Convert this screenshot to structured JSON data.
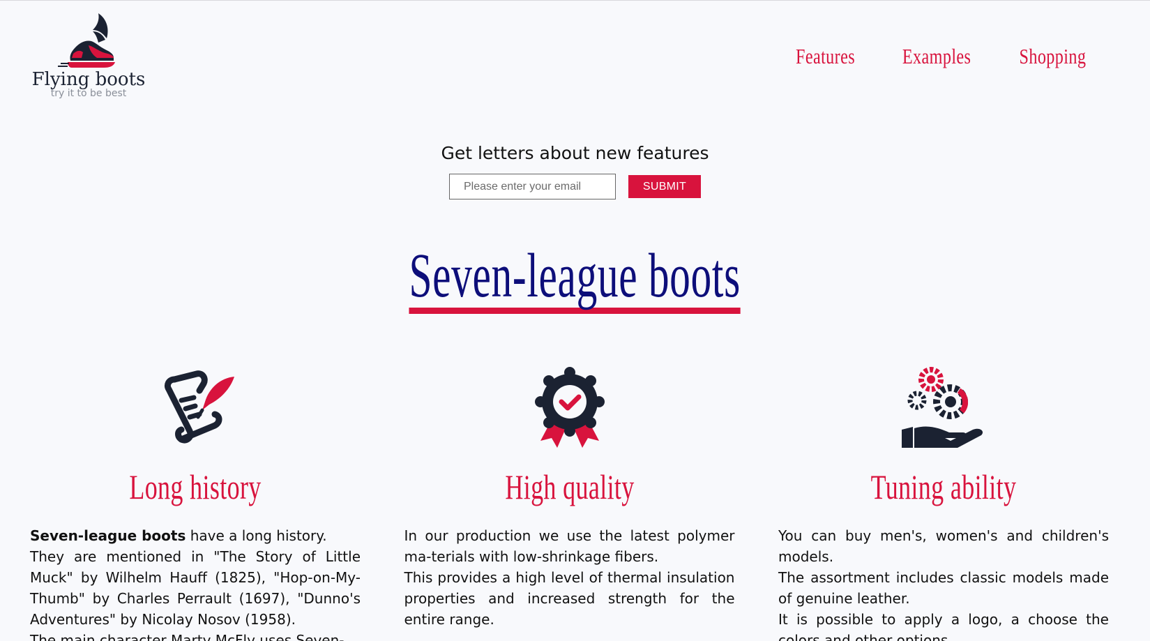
{
  "brand": {
    "name": "Flying boots",
    "tagline": "try it to be best",
    "colors": {
      "accent": "#d8133d",
      "dark": "#1b2232",
      "headline": "#0d0e7a"
    }
  },
  "nav": {
    "items": [
      {
        "label": "Features"
      },
      {
        "label": "Examples"
      },
      {
        "label": "Shopping"
      }
    ]
  },
  "subscribe": {
    "heading": "Get letters about new features",
    "email_placeholder": "Please enter your email",
    "email_value": "",
    "submit_label": "SUBMIT"
  },
  "hero": {
    "title": "Seven-league boots"
  },
  "features": [
    {
      "icon": "scroll-quill-icon",
      "title": "Long history",
      "lead_bold": "Seven-league boots",
      "lead_rest": " have a long history.",
      "paragraphs": [
        "They are mentioned in \"The Story of Little Muck\" by Wilhelm Hauff (1825), \"Hop-on-My-Thumb\" by Charles Perrault (1697), \"Dunno's Adventures\" by Nicolay Nosov (1958).",
        "The main character Marty McFly uses Seven-"
      ]
    },
    {
      "icon": "award-badge-icon",
      "title": "High quality",
      "paragraphs": [
        "In our production we use the latest polymer ma-terials with low-shrinkage fibers.",
        "This provides a high level of thermal insulation properties and increased strength for the entire range."
      ]
    },
    {
      "icon": "gears-hand-icon",
      "title": "Tuning ability",
      "paragraphs": [
        "You can buy men's, women's and children's models.",
        "The assortment includes classic models made of genuine leather.",
        "It is possible to apply a logo, a choose the colors and other options."
      ]
    }
  ]
}
